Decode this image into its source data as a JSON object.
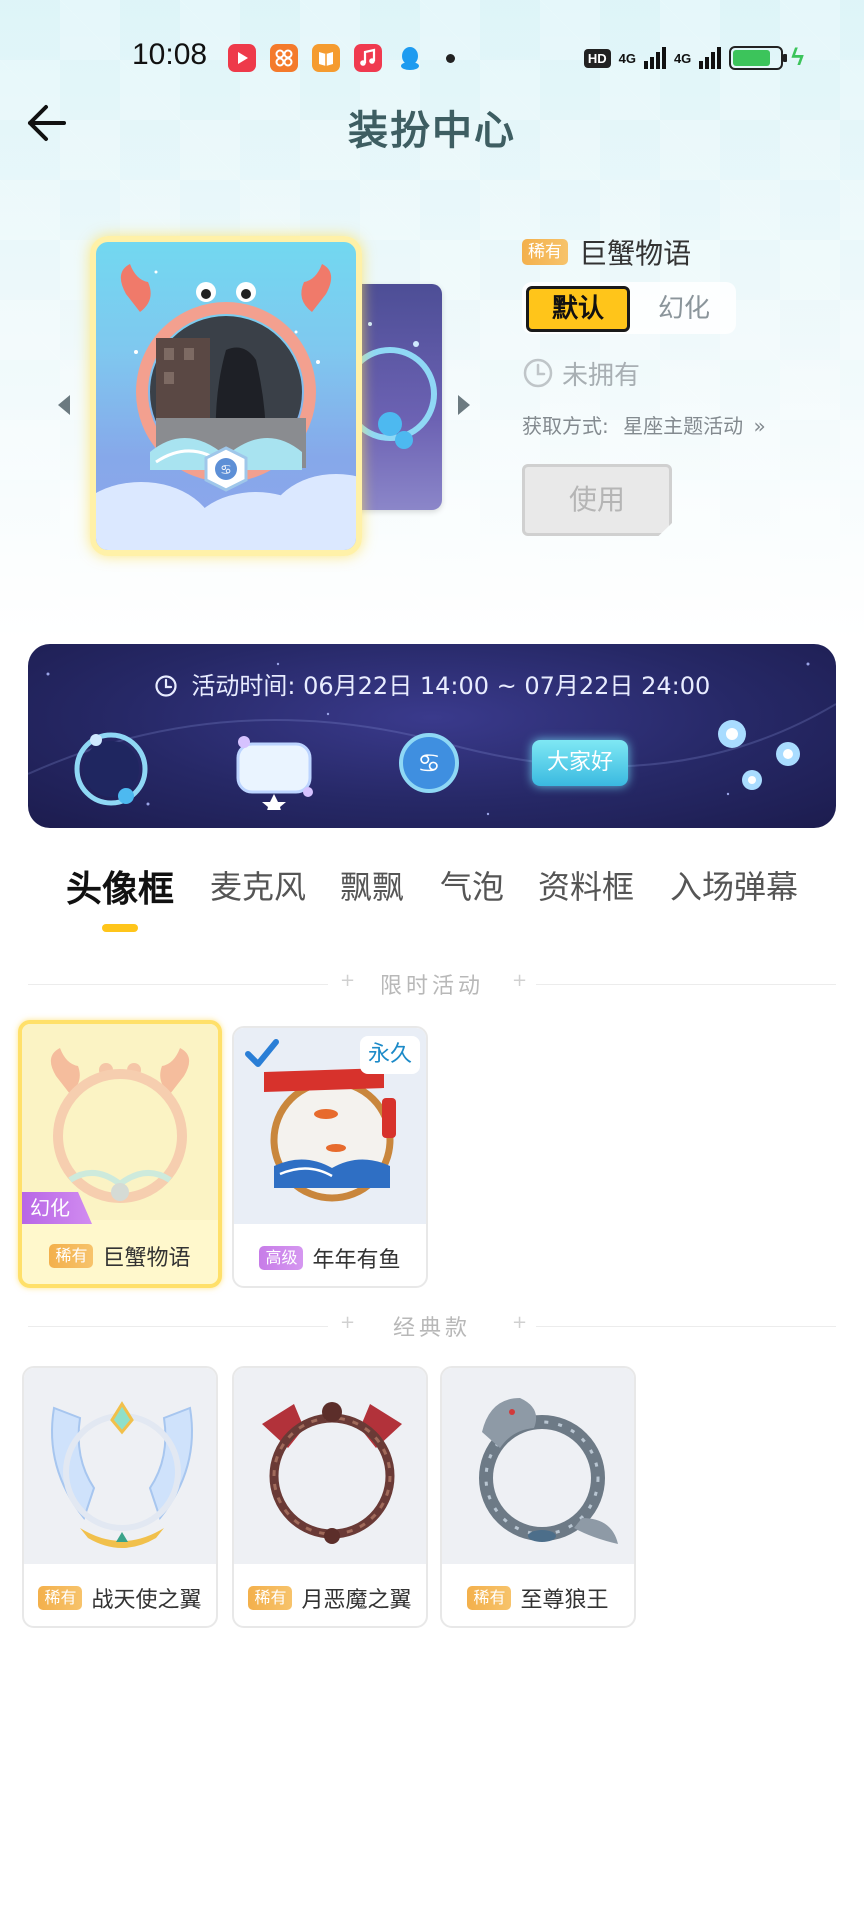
{
  "status_bar": {
    "time": "10:08",
    "hd_label": "HD",
    "net1": "4G",
    "net2": "4G",
    "battery_level": 0.8
  },
  "header": {
    "title": "装扮中心"
  },
  "preview": {
    "rarity_badge": "稀有",
    "item_name": "巨蟹物语",
    "toggle_default": "默认",
    "toggle_morph": "幻化",
    "owned_status": "未拥有",
    "source_label": "获取方式:",
    "source_value": "星座主题活动",
    "use_button": "使用"
  },
  "banner": {
    "time_text": "活动时间: 06月22日 14:00 ~ 07月22日 24:00",
    "hello_label": "大家好"
  },
  "tabs": [
    {
      "label": "头像框",
      "active": true
    },
    {
      "label": "麦克风"
    },
    {
      "label": "飘飘"
    },
    {
      "label": "气泡"
    },
    {
      "label": "资料框"
    },
    {
      "label": "入场弹幕"
    }
  ],
  "sections": {
    "limited": "限时活动",
    "classic": "经典款"
  },
  "limited_items": [
    {
      "badge": "稀有",
      "name": "巨蟹物语",
      "tag": "幻化"
    },
    {
      "badge": "高级",
      "name": "年年有鱼",
      "tag": "永久"
    }
  ],
  "classic_items": [
    {
      "badge": "稀有",
      "name": "战天使之翼"
    },
    {
      "badge": "稀有",
      "name": "月恶魔之翼"
    },
    {
      "badge": "稀有",
      "name": "至尊狼王"
    }
  ],
  "colors": {
    "accent_yellow": "#ffc51a",
    "rare_badge": "#f3b04c",
    "senior_badge": "#c77ce8",
    "banner_bg": "#262866"
  }
}
